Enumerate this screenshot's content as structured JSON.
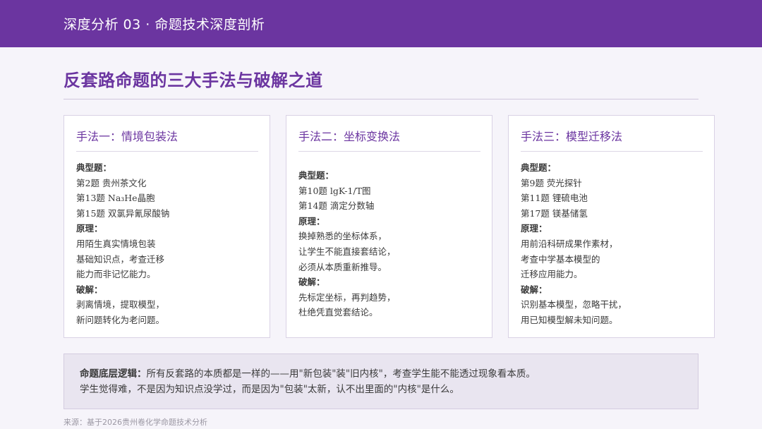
{
  "header": {
    "title": "深度分析 03 · 命题技术深度剖析"
  },
  "page_title": "反套路命题的三大手法与破解之道",
  "cards": [
    {
      "title": "手法一：情境包装法",
      "lines": [
        {
          "text": "典型题：",
          "bold": true
        },
        {
          "text": "第2题 贵州茶文化",
          "bold": false
        },
        {
          "text": "第13题 Na₃He晶胞",
          "bold": false
        },
        {
          "text": "第15题 双氯异氰尿酸钠",
          "bold": false
        },
        {
          "text": "原理：",
          "bold": true
        },
        {
          "text": "用陌生真实情境包装",
          "bold": false
        },
        {
          "text": "基础知识点，考查迁移",
          "bold": false
        },
        {
          "text": "能力而非记忆能力。",
          "bold": false
        },
        {
          "text": "破解：",
          "bold": true
        },
        {
          "text": "剥离情境，提取模型，",
          "bold": false
        },
        {
          "text": "新问题转化为老问题。",
          "bold": false
        }
      ]
    },
    {
      "title": "手法二：坐标变换法",
      "lines": [
        {
          "text": "典型题：",
          "bold": true
        },
        {
          "text": "第10题 lgK-1/T图",
          "bold": false
        },
        {
          "text": "第14题 滴定分数轴",
          "bold": false
        },
        {
          "text": "原理：",
          "bold": true
        },
        {
          "text": "换掉熟悉的坐标体系，",
          "bold": false
        },
        {
          "text": "让学生不能直接套结论，",
          "bold": false
        },
        {
          "text": "必须从本质重新推导。",
          "bold": false
        },
        {
          "text": "破解：",
          "bold": true
        },
        {
          "text": "先标定坐标，再判趋势，",
          "bold": false
        },
        {
          "text": "杜绝凭直觉套结论。",
          "bold": false
        }
      ]
    },
    {
      "title": "手法三：模型迁移法",
      "lines": [
        {
          "text": "典型题：",
          "bold": true
        },
        {
          "text": "第9题 荧光探针",
          "bold": false
        },
        {
          "text": "第11题 锂硫电池",
          "bold": false
        },
        {
          "text": "第17题 镁基储氢",
          "bold": false
        },
        {
          "text": "原理：",
          "bold": true
        },
        {
          "text": "用前沿科研成果作素材，",
          "bold": false
        },
        {
          "text": "考查中学基本模型的",
          "bold": false
        },
        {
          "text": "迁移应用能力。",
          "bold": false
        },
        {
          "text": "破解：",
          "bold": true
        },
        {
          "text": "识别基本模型，忽略干扰，",
          "bold": false
        },
        {
          "text": "用已知模型解未知问题。",
          "bold": false
        }
      ]
    }
  ],
  "summary": {
    "label": "命题底层逻辑：",
    "line1": "所有反套路的本质都是一样的——用\"新包装\"装\"旧内核\"，考查学生能不能透过现象看本质。",
    "line2": "学生觉得难，不是因为知识点没学过，而是因为\"包装\"太新，认不出里面的\"内核\"是什么。"
  },
  "source": "来源：基于2026贵州卷化学命题技术分析",
  "colors": {
    "accent": "#6b35a0",
    "background": "#f6f4fa",
    "summary_bg": "#e9e5f0"
  }
}
